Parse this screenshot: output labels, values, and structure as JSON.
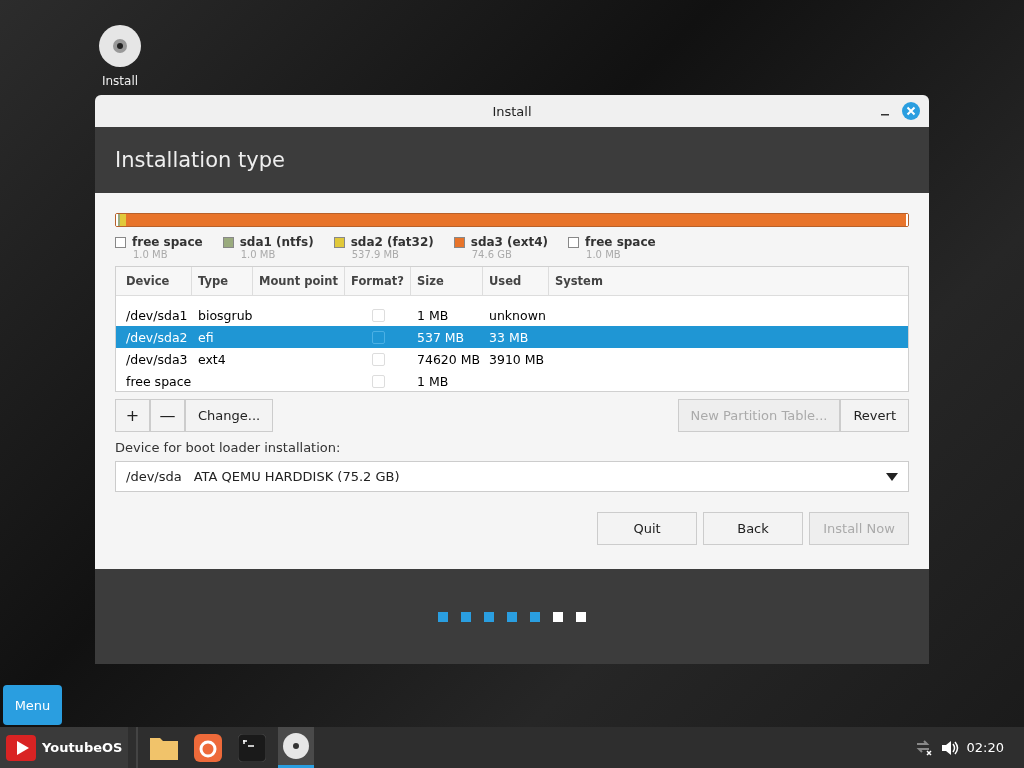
{
  "desktop_icon": {
    "label": "Install"
  },
  "window": {
    "title": "Install",
    "heading": "Installation type"
  },
  "partition_bar": {
    "legend": [
      {
        "label": "free space",
        "size": "1.0 MB",
        "color": "#ffffff",
        "level": 0.002
      },
      {
        "label": "sda1 (ntfs)",
        "size": "1.0 MB",
        "color": "#9aab7e",
        "level": 0.002
      },
      {
        "label": "sda2 (fat32)",
        "size": "537.9 MB",
        "color": "#e1c93a",
        "level": 0.007
      },
      {
        "label": "sda3 (ext4)",
        "size": "74.6 GB",
        "color": "#e8742a",
        "level": 0.987
      },
      {
        "label": "free space",
        "size": "1.0 MB",
        "color": "#ffffff",
        "level": 0.002
      }
    ]
  },
  "table": {
    "columns": [
      "Device",
      "Type",
      "Mount point",
      "Format?",
      "Size",
      "Used",
      "System"
    ],
    "rows": [
      {
        "device": "/dev/sda1",
        "type": "biosgrub",
        "format": false,
        "size": "1 MB",
        "used": "unknown",
        "selected": false
      },
      {
        "device": "/dev/sda2",
        "type": "efi",
        "format": false,
        "size": "537 MB",
        "used": "33 MB",
        "selected": true
      },
      {
        "device": "/dev/sda3",
        "type": "ext4",
        "format": false,
        "size": "74620 MB",
        "used": "3910 MB",
        "selected": false
      },
      {
        "device": "free space",
        "format": false,
        "size": "1 MB",
        "selected": false
      }
    ]
  },
  "partition_buttons": {
    "add": "+",
    "remove": "—",
    "change": "Change...",
    "new_table": {
      "label": "New Partition Table...",
      "disabled": true
    },
    "revert": "Revert"
  },
  "boot_loader": {
    "label": "Device for boot loader installation:",
    "device": "/dev/sda",
    "description": "ATA QEMU HARDDISK (75.2 GB)"
  },
  "buttons": [
    {
      "label": "Quit",
      "disabled": false
    },
    {
      "label": "Back",
      "disabled": false
    },
    {
      "label": "Install Now",
      "disabled": true
    }
  ],
  "steps": [
    {
      "done": true
    },
    {
      "done": true
    },
    {
      "done": true
    },
    {
      "done": true
    },
    {
      "done": true
    },
    {
      "done": false
    },
    {
      "done": false
    }
  ],
  "menu_button": "Menu",
  "taskbar": {
    "start_label": "YoutubeOS",
    "apps": [
      {
        "kind": "folder",
        "active": false
      },
      {
        "kind": "browser",
        "active": false
      },
      {
        "kind": "terminal",
        "active": false
      },
      {
        "kind": "disc",
        "active": true
      }
    ],
    "clock": "02:20"
  }
}
